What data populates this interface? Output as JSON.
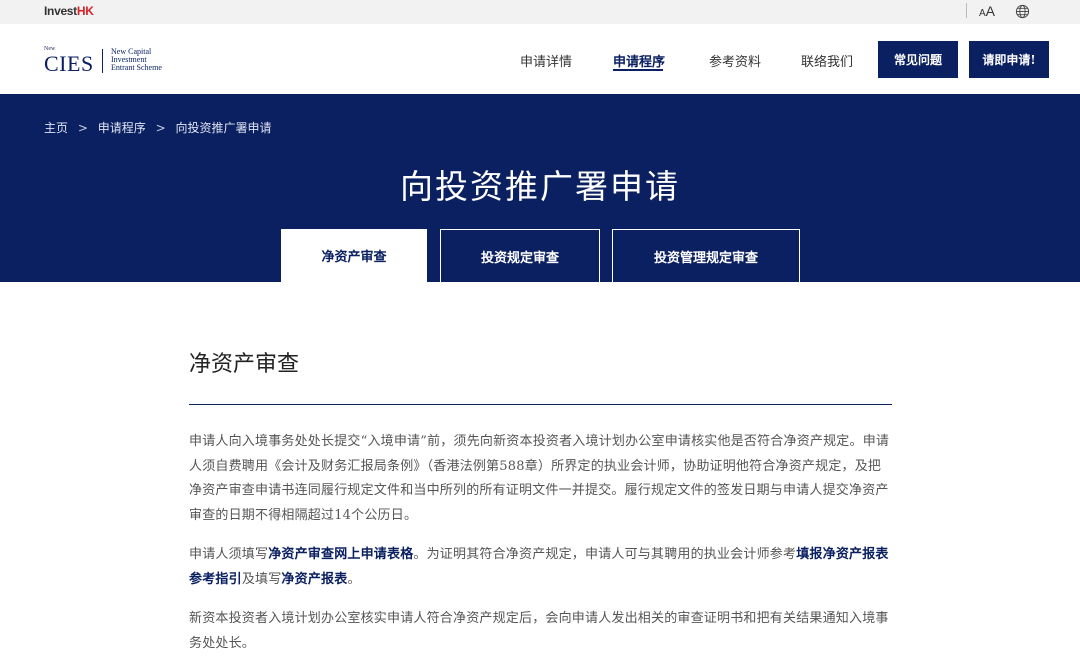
{
  "topbar": {
    "logo_invest": "Invest",
    "logo_hk": "HK",
    "font_small": "A",
    "font_big": "A",
    "globe_icon": "globe-icon"
  },
  "header": {
    "logo": {
      "new": "New",
      "cies": "CIES",
      "line1": "New Capital",
      "line2": "Investment",
      "line3": "Entrant Scheme"
    },
    "nav": [
      {
        "label": "申请详情"
      },
      {
        "label": "申请程序"
      },
      {
        "label": "参考资料"
      },
      {
        "label": "联络我们"
      }
    ],
    "faq_label": "常见问题",
    "apply_label": "请即申请!"
  },
  "hero": {
    "breadcrumb": [
      "主页",
      ">",
      "申请程序",
      ">",
      "向投资推广署申请"
    ],
    "title": "向投资推广署申请",
    "tabs": [
      {
        "label": "净资产审查",
        "active": true
      },
      {
        "label": "投资规定审查",
        "active": false
      },
      {
        "label": "投资管理规定审查",
        "active": false
      }
    ]
  },
  "content": {
    "title": "净资产审查",
    "p1": "申请人向入境事务处处长提交“入境申请”前，须先向新资本投资者入境计划办公室申请核实他是否符合净资产规定。申请人须自费聘用《会计及财务汇报局条例》（香港法例第588章）所界定的执业会计师，协助证明他符合净资产规定，及把净资产审查申请书连同履行规定文件和当中所列的所有证明文件一并提交。履行规定文件的签发日期与申请人提交净资产审查的日期不得相隔超过14个公历日。",
    "p2": {
      "t1": "申请人须填写",
      "link1": "净资产审查网上申请表格",
      "t2": "。为证明其符合净资产规定，申请人可与其聘用的执业会计师参考",
      "link2": "填报净资产报表参考指引",
      "t3": "及填写",
      "link3": "净资产报表",
      "t4": "。"
    },
    "p3": "新资本投资者入境计划办公室核实申请人符合净资产规定后，会向申请人发出相关的审查证明书和把有关结果通知入境事务处处长。"
  },
  "colors": {
    "brand_navy": "#0b2061",
    "hk_red": "#d8232a",
    "topbar_bg": "#f2f2f2"
  }
}
